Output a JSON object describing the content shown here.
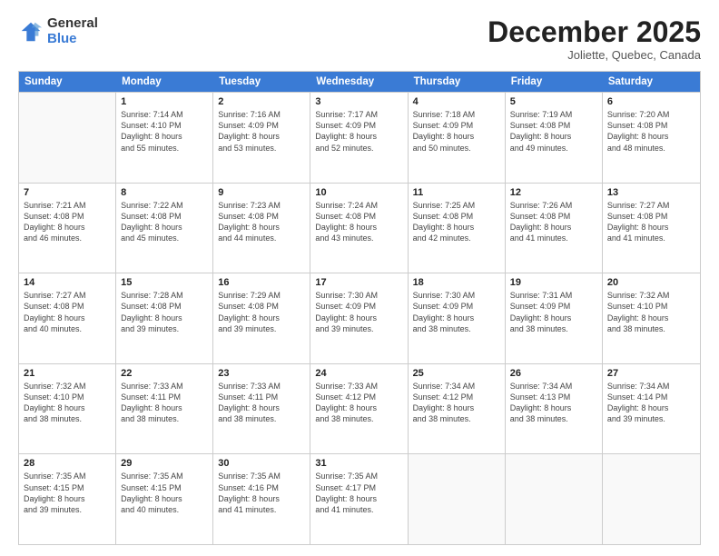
{
  "logo": {
    "general": "General",
    "blue": "Blue"
  },
  "title": "December 2025",
  "subtitle": "Joliette, Quebec, Canada",
  "days_of_week": [
    "Sunday",
    "Monday",
    "Tuesday",
    "Wednesday",
    "Thursday",
    "Friday",
    "Saturday"
  ],
  "weeks": [
    [
      {
        "day": "",
        "info": ""
      },
      {
        "day": "1",
        "info": "Sunrise: 7:14 AM\nSunset: 4:10 PM\nDaylight: 8 hours\nand 55 minutes."
      },
      {
        "day": "2",
        "info": "Sunrise: 7:16 AM\nSunset: 4:09 PM\nDaylight: 8 hours\nand 53 minutes."
      },
      {
        "day": "3",
        "info": "Sunrise: 7:17 AM\nSunset: 4:09 PM\nDaylight: 8 hours\nand 52 minutes."
      },
      {
        "day": "4",
        "info": "Sunrise: 7:18 AM\nSunset: 4:09 PM\nDaylight: 8 hours\nand 50 minutes."
      },
      {
        "day": "5",
        "info": "Sunrise: 7:19 AM\nSunset: 4:08 PM\nDaylight: 8 hours\nand 49 minutes."
      },
      {
        "day": "6",
        "info": "Sunrise: 7:20 AM\nSunset: 4:08 PM\nDaylight: 8 hours\nand 48 minutes."
      }
    ],
    [
      {
        "day": "7",
        "info": "Sunrise: 7:21 AM\nSunset: 4:08 PM\nDaylight: 8 hours\nand 46 minutes."
      },
      {
        "day": "8",
        "info": "Sunrise: 7:22 AM\nSunset: 4:08 PM\nDaylight: 8 hours\nand 45 minutes."
      },
      {
        "day": "9",
        "info": "Sunrise: 7:23 AM\nSunset: 4:08 PM\nDaylight: 8 hours\nand 44 minutes."
      },
      {
        "day": "10",
        "info": "Sunrise: 7:24 AM\nSunset: 4:08 PM\nDaylight: 8 hours\nand 43 minutes."
      },
      {
        "day": "11",
        "info": "Sunrise: 7:25 AM\nSunset: 4:08 PM\nDaylight: 8 hours\nand 42 minutes."
      },
      {
        "day": "12",
        "info": "Sunrise: 7:26 AM\nSunset: 4:08 PM\nDaylight: 8 hours\nand 41 minutes."
      },
      {
        "day": "13",
        "info": "Sunrise: 7:27 AM\nSunset: 4:08 PM\nDaylight: 8 hours\nand 41 minutes."
      }
    ],
    [
      {
        "day": "14",
        "info": "Sunrise: 7:27 AM\nSunset: 4:08 PM\nDaylight: 8 hours\nand 40 minutes."
      },
      {
        "day": "15",
        "info": "Sunrise: 7:28 AM\nSunset: 4:08 PM\nDaylight: 8 hours\nand 39 minutes."
      },
      {
        "day": "16",
        "info": "Sunrise: 7:29 AM\nSunset: 4:08 PM\nDaylight: 8 hours\nand 39 minutes."
      },
      {
        "day": "17",
        "info": "Sunrise: 7:30 AM\nSunset: 4:09 PM\nDaylight: 8 hours\nand 39 minutes."
      },
      {
        "day": "18",
        "info": "Sunrise: 7:30 AM\nSunset: 4:09 PM\nDaylight: 8 hours\nand 38 minutes."
      },
      {
        "day": "19",
        "info": "Sunrise: 7:31 AM\nSunset: 4:09 PM\nDaylight: 8 hours\nand 38 minutes."
      },
      {
        "day": "20",
        "info": "Sunrise: 7:32 AM\nSunset: 4:10 PM\nDaylight: 8 hours\nand 38 minutes."
      }
    ],
    [
      {
        "day": "21",
        "info": "Sunrise: 7:32 AM\nSunset: 4:10 PM\nDaylight: 8 hours\nand 38 minutes."
      },
      {
        "day": "22",
        "info": "Sunrise: 7:33 AM\nSunset: 4:11 PM\nDaylight: 8 hours\nand 38 minutes."
      },
      {
        "day": "23",
        "info": "Sunrise: 7:33 AM\nSunset: 4:11 PM\nDaylight: 8 hours\nand 38 minutes."
      },
      {
        "day": "24",
        "info": "Sunrise: 7:33 AM\nSunset: 4:12 PM\nDaylight: 8 hours\nand 38 minutes."
      },
      {
        "day": "25",
        "info": "Sunrise: 7:34 AM\nSunset: 4:12 PM\nDaylight: 8 hours\nand 38 minutes."
      },
      {
        "day": "26",
        "info": "Sunrise: 7:34 AM\nSunset: 4:13 PM\nDaylight: 8 hours\nand 38 minutes."
      },
      {
        "day": "27",
        "info": "Sunrise: 7:34 AM\nSunset: 4:14 PM\nDaylight: 8 hours\nand 39 minutes."
      }
    ],
    [
      {
        "day": "28",
        "info": "Sunrise: 7:35 AM\nSunset: 4:15 PM\nDaylight: 8 hours\nand 39 minutes."
      },
      {
        "day": "29",
        "info": "Sunrise: 7:35 AM\nSunset: 4:15 PM\nDaylight: 8 hours\nand 40 minutes."
      },
      {
        "day": "30",
        "info": "Sunrise: 7:35 AM\nSunset: 4:16 PM\nDaylight: 8 hours\nand 41 minutes."
      },
      {
        "day": "31",
        "info": "Sunrise: 7:35 AM\nSunset: 4:17 PM\nDaylight: 8 hours\nand 41 minutes."
      },
      {
        "day": "",
        "info": ""
      },
      {
        "day": "",
        "info": ""
      },
      {
        "day": "",
        "info": ""
      }
    ]
  ]
}
